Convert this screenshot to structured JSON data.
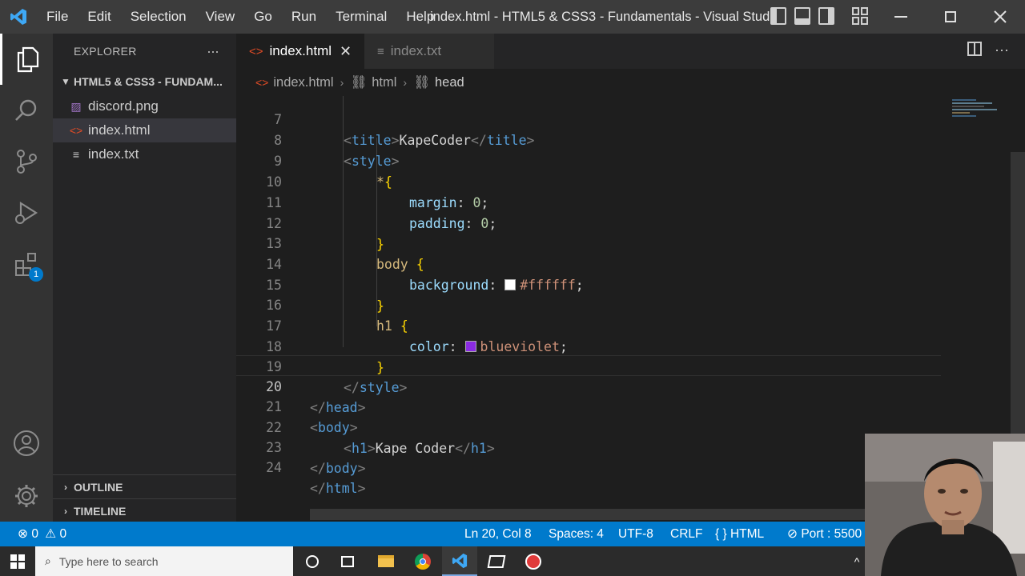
{
  "window": {
    "title": "index.html - HTML5 & CSS3 - Fundamentals - Visual Stud...",
    "menu": [
      "File",
      "Edit",
      "Selection",
      "View",
      "Go",
      "Run",
      "Terminal",
      "Help"
    ]
  },
  "activity_bar": {
    "items": [
      "explorer-icon",
      "search-icon",
      "source-control-icon",
      "run-debug-icon",
      "extensions-icon"
    ],
    "extensions_badge": "1",
    "bottom": [
      "accounts-icon",
      "manage-gear-icon"
    ]
  },
  "sidebar": {
    "header": "EXPLORER",
    "more": "···",
    "folder": "HTML5 & CSS3 - FUNDAM...",
    "files": [
      {
        "name": "discord.png",
        "icon": "image-icon"
      },
      {
        "name": "index.html",
        "icon": "html-icon"
      },
      {
        "name": "index.txt",
        "icon": "text-file-icon"
      }
    ],
    "sections": [
      "OUTLINE",
      "TIMELINE"
    ]
  },
  "tabs": [
    {
      "label": "index.html",
      "icon": "html-icon",
      "active": true
    },
    {
      "label": "index.txt",
      "icon": "text-file-icon",
      "active": false
    }
  ],
  "breadcrumb": [
    "index.html",
    "html",
    "head"
  ],
  "editor": {
    "current_line": "20",
    "lines": [
      {
        "n": "7"
      },
      {
        "n": "8"
      },
      {
        "n": "9"
      },
      {
        "n": "10"
      },
      {
        "n": "11"
      },
      {
        "n": "12"
      },
      {
        "n": "13"
      },
      {
        "n": "14"
      },
      {
        "n": "15"
      },
      {
        "n": "16"
      },
      {
        "n": "17"
      },
      {
        "n": "18"
      },
      {
        "n": "19"
      },
      {
        "n": "20"
      },
      {
        "n": "21"
      },
      {
        "n": "22"
      },
      {
        "n": "23"
      },
      {
        "n": "24"
      }
    ],
    "tokens": {
      "title_text": "KapeCoder",
      "style_tag": "style",
      "universal": "*",
      "margin_prop": "margin",
      "margin_val": "0",
      "padding_prop": "padding",
      "padding_val": "0",
      "body_sel": "body",
      "background_prop": "background",
      "background_val": "#ffffff",
      "h1_sel": "h1",
      "color_prop": "color",
      "color_val": "blueviolet",
      "head_tag": "head",
      "body_tag": "body",
      "h1_tag": "h1",
      "h1_text": "Kape Coder",
      "html_tag": "html",
      "title_tag": "title"
    },
    "swatch_colors": {
      "white": "#ffffff",
      "blueviolet": "#8a2be2"
    }
  },
  "statusbar": {
    "errors": "0",
    "warnings": "0",
    "position": "Ln 20, Col 8",
    "spaces": "Spaces: 4",
    "encoding": "UTF-8",
    "eol": "CRLF",
    "language": "HTML",
    "port": "Port : 5500"
  },
  "taskbar": {
    "search_placeholder": "Type here to search"
  },
  "colors": {
    "statusbar": "#007acc",
    "titlebar": "#3c3c3c",
    "activitybar": "#333333",
    "sidebar": "#252526",
    "editor": "#1e1e1e"
  }
}
